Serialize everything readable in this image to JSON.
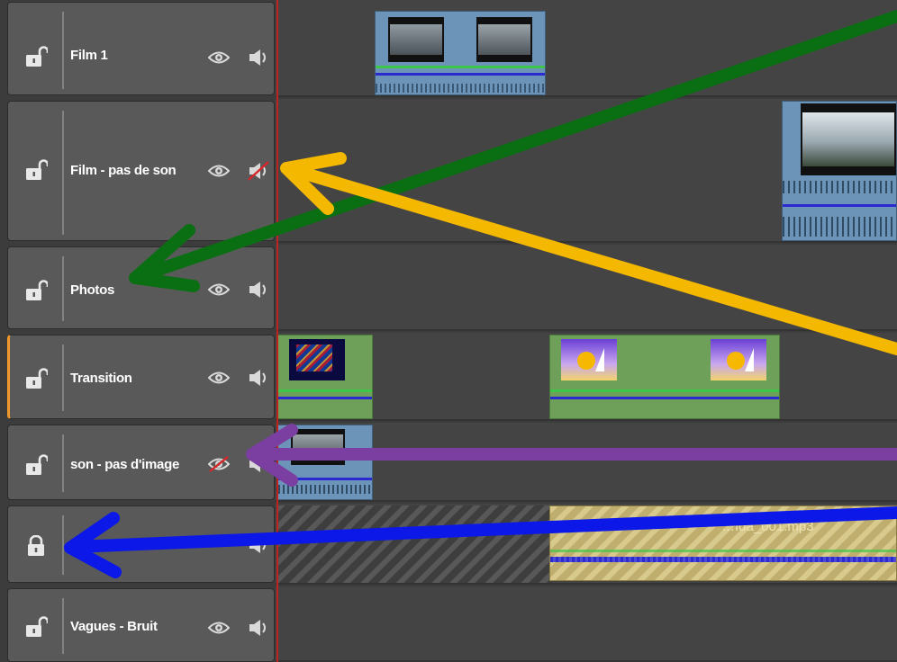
{
  "tracks": [
    {
      "name": "Film 1"
    },
    {
      "name": "Film - pas de son"
    },
    {
      "name": "Photos"
    },
    {
      "name": "Transition"
    },
    {
      "name": "son - pas d'image"
    },
    {
      "name": ""
    },
    {
      "name": "Vagues - Bruit"
    }
  ],
  "clips": {
    "locked_clip_title": "…Ida_001.mp3"
  },
  "colors": {
    "green_arrow": "#0a6e12",
    "yellow_arrow": "#f4b800",
    "purple_arrow": "#7a3fa0",
    "blue_arrow": "#0b18e8",
    "playhead": "#c0221e",
    "selected_track": "#f0982a",
    "clip_blue": "#6c94b8",
    "clip_green": "#6fa05a"
  },
  "icons": [
    "lock-open-icon",
    "lock-closed-icon",
    "eye-icon",
    "eye-muted-icon",
    "speaker-icon",
    "speaker-muted-icon"
  ]
}
